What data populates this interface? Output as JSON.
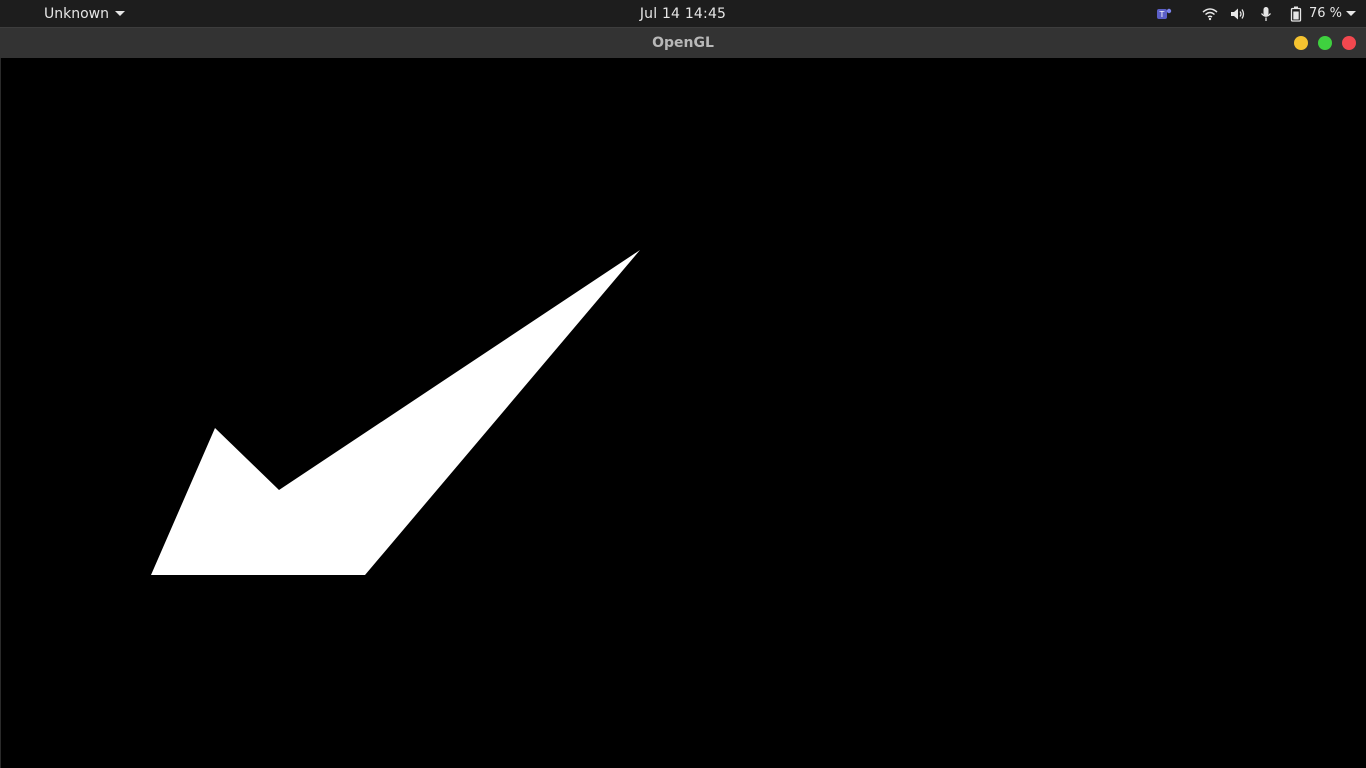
{
  "topbar": {
    "activities_label": "Unknown",
    "clock": "Jul 14  14:45",
    "battery_percent": "76 %",
    "icons": [
      "teams-icon",
      "wifi-icon",
      "volume-icon",
      "microphone-icon",
      "battery-icon",
      "chevron-down-icon"
    ]
  },
  "window": {
    "title": "OpenGL",
    "controls": {
      "minimize_color": "#f5c330",
      "maximize_color": "#3fd13f",
      "close_color": "#f2484f"
    },
    "canvas": {
      "background": "#000000",
      "shape_color": "#ffffff",
      "shape": "white polygon (checkmark-like arrow)"
    }
  }
}
